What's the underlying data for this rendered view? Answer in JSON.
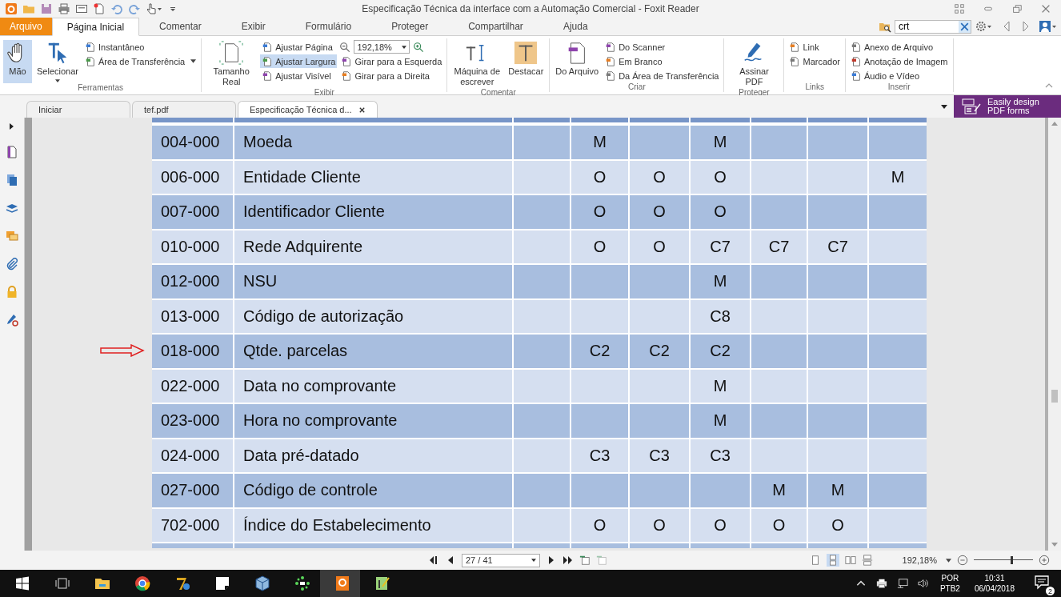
{
  "window": {
    "title": "Especificação Técnica da interface com a Automação Comercial - Foxit Reader"
  },
  "ribbon_tabs": [
    {
      "label": "Arquivo",
      "kind": "file",
      "selected": false
    },
    {
      "label": "Página Inicial",
      "kind": "tab",
      "selected": true
    },
    {
      "label": "Comentar",
      "kind": "tab",
      "selected": false
    },
    {
      "label": "Exibir",
      "kind": "tab",
      "selected": false
    },
    {
      "label": "Formulário",
      "kind": "tab",
      "selected": false
    },
    {
      "label": "Proteger",
      "kind": "tab",
      "selected": false
    },
    {
      "label": "Compartilhar",
      "kind": "tab",
      "selected": false
    },
    {
      "label": "Ajuda",
      "kind": "tab",
      "selected": false
    }
  ],
  "search": {
    "value": "crt"
  },
  "groups": [
    {
      "title": "Ferramentas",
      "columns": [
        {
          "kind": "large",
          "label": "Mão",
          "selected": true
        },
        {
          "kind": "large",
          "label": "Selecionar",
          "selected": false,
          "menu": true
        },
        {
          "kind": "stack",
          "items": [
            {
              "kind": "small",
              "label": "Instantâneo",
              "selected": false
            },
            {
              "kind": "small",
              "label": "Área de Transferência",
              "selected": false,
              "menu": true
            }
          ]
        }
      ]
    },
    {
      "title": "Exibir",
      "columns": [
        {
          "kind": "large",
          "label": "Tamanho Real",
          "selected": false
        },
        {
          "kind": "stack",
          "items": [
            {
              "kind": "small",
              "label": "Ajustar Página",
              "selected": false
            },
            {
              "kind": "small",
              "label": "Ajustar Largura",
              "selected": true
            },
            {
              "kind": "small",
              "label": "Ajustar Visível",
              "selected": false
            }
          ]
        },
        {
          "kind": "stack",
          "items": [
            {
              "kind": "zoom",
              "value": "192,18%"
            },
            {
              "kind": "small",
              "label": "Girar para a Esquerda",
              "selected": false
            },
            {
              "kind": "small",
              "label": "Girar para a Direita",
              "selected": false
            }
          ]
        }
      ]
    },
    {
      "title": "Comentar",
      "columns": [
        {
          "kind": "large",
          "label": "Máquina de escrever",
          "selected": false
        },
        {
          "kind": "large",
          "label": "Destacar",
          "selected": false
        }
      ]
    },
    {
      "title": "Criar",
      "columns": [
        {
          "kind": "large",
          "label": "Do Arquivo",
          "selected": false
        },
        {
          "kind": "stack",
          "items": [
            {
              "kind": "small",
              "label": "Do Scanner",
              "selected": false
            },
            {
              "kind": "small",
              "label": "Em Branco",
              "selected": false
            },
            {
              "kind": "small",
              "label": "Da Área de Transferência",
              "selected": false
            }
          ]
        }
      ]
    },
    {
      "title": "Proteger",
      "columns": [
        {
          "kind": "large",
          "label": "Assinar PDF",
          "selected": false
        }
      ]
    },
    {
      "title": "Links",
      "columns": [
        {
          "kind": "stack",
          "items": [
            {
              "kind": "small",
              "label": "Link",
              "selected": false
            },
            {
              "kind": "small",
              "label": "Marcador",
              "selected": false
            }
          ]
        }
      ]
    },
    {
      "title": "Inserir",
      "columns": [
        {
          "kind": "stack",
          "items": [
            {
              "kind": "small",
              "label": "Anexo de Arquivo",
              "selected": false
            },
            {
              "kind": "small",
              "label": "Anotação de Imagem",
              "selected": false
            },
            {
              "kind": "small",
              "label": "Áudio e Vídeo",
              "selected": false
            }
          ]
        }
      ]
    }
  ],
  "doc_tabs": [
    {
      "label": "Iniciar",
      "selected": false
    },
    {
      "label": "tef.pdf",
      "selected": false
    },
    {
      "label": "Especificação Técnica d...",
      "selected": true
    }
  ],
  "promo": {
    "text": "Easily design PDF forms"
  },
  "table": {
    "rows": [
      {
        "code": "004-000",
        "name": "Moeda",
        "cells": {
          "column_4": "M",
          "column_6": "M"
        }
      },
      {
        "code": "006-000",
        "name": "Entidade Cliente",
        "cells": {
          "column_4": "O",
          "column_5": "O",
          "column_6": "O",
          "column_9": "M"
        }
      },
      {
        "code": "007-000",
        "name": "Identificador Cliente",
        "cells": {
          "column_4": "O",
          "column_5": "O",
          "column_6": "O"
        }
      },
      {
        "code": "010-000",
        "name": "Rede Adquirente",
        "cells": {
          "column_4": "O",
          "column_5": "O",
          "column_6": "C7",
          "column_7": "C7",
          "column_8": "C7"
        }
      },
      {
        "code": "012-000",
        "name": "NSU",
        "cells": {
          "column_6": "M"
        }
      },
      {
        "code": "013-000",
        "name": "Código de autorização",
        "cells": {
          "column_6": "C8"
        }
      },
      {
        "code": "018-000",
        "name": "Qtde. parcelas",
        "cells": {
          "column_4": "C2",
          "column_5": "C2",
          "column_6": "C2"
        }
      },
      {
        "code": "022-000",
        "name": "Data no comprovante",
        "cells": {
          "column_6": "M"
        }
      },
      {
        "code": "023-000",
        "name": "Hora no comprovante",
        "cells": {
          "column_6": "M"
        }
      },
      {
        "code": "024-000",
        "name": "Data pré-datado",
        "cells": {
          "column_4": "C3",
          "column_5": "C3",
          "column_6": "C3"
        }
      },
      {
        "code": "027-000",
        "name": "Código de controle",
        "cells": {
          "column_7": "M",
          "column_8": "M"
        }
      },
      {
        "code": "702-000",
        "name": "Índice do Estabelecimento",
        "cells": {
          "column_4": "O",
          "column_5": "O",
          "column_6": "O",
          "column_7": "O",
          "column_8": "O"
        }
      }
    ]
  },
  "status_bar": {
    "page": "27 / 41",
    "zoom": "192,18%",
    "zoom_slider": {
      "level": 0.63
    }
  },
  "taskbar": {
    "language": "POR",
    "layout": "PTB2",
    "time": "10:31",
    "date": "06/04/2018",
    "notifications": "2"
  }
}
